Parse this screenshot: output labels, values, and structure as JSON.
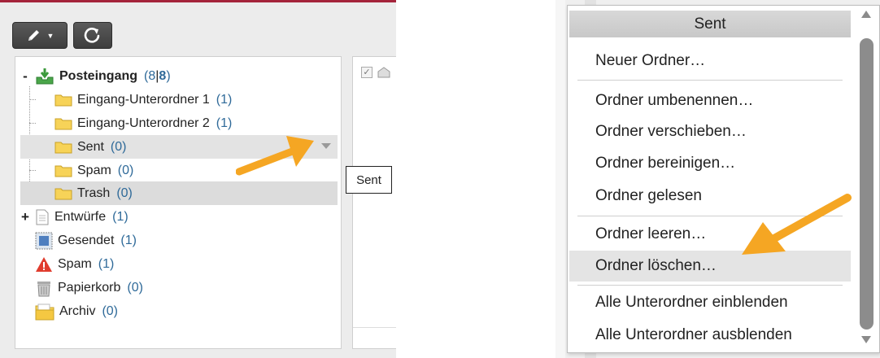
{
  "toolbar": {
    "edit_icon": "pencil-icon",
    "refresh_icon": "refresh-icon"
  },
  "tree": {
    "inbox": {
      "label": "Posteingang",
      "count_open": "(8",
      "sep": "|",
      "unread": "8",
      "count_close": ")"
    },
    "subfolders": [
      {
        "label": "Eingang-Unterordner 1",
        "count": "(1)"
      },
      {
        "label": "Eingang-Unterordner 2",
        "count": "(1)"
      },
      {
        "label": "Sent",
        "count": "(0)"
      },
      {
        "label": "Spam",
        "count": "(0)"
      },
      {
        "label": "Trash",
        "count": "(0)"
      }
    ],
    "folders": [
      {
        "label": "Entwürfe",
        "count": "(1)"
      },
      {
        "label": "Gesendet",
        "count": "(1)"
      },
      {
        "label": "Spam",
        "count": "(1)"
      },
      {
        "label": "Papierkorb",
        "count": "(0)"
      },
      {
        "label": "Archiv",
        "count": "(0)"
      }
    ],
    "expand_minus": "-",
    "expand_plus": "+"
  },
  "tooltip": "Sent",
  "context_menu": {
    "header": "Sent",
    "items": [
      "Neuer Ordner…",
      "Ordner umbenennen…",
      "Ordner verschieben…",
      "Ordner bereinigen…",
      "Ordner gelesen",
      "Ordner leeren…",
      "Ordner löschen…",
      "Alle Unterordner einblenden",
      "Alle Unterordner ausblenden"
    ]
  },
  "colors": {
    "accent_top_border": "#a4243b",
    "count_blue": "#2f6a99",
    "arrow_orange": "#f5a623",
    "folder_yellow": "#f7d358"
  }
}
